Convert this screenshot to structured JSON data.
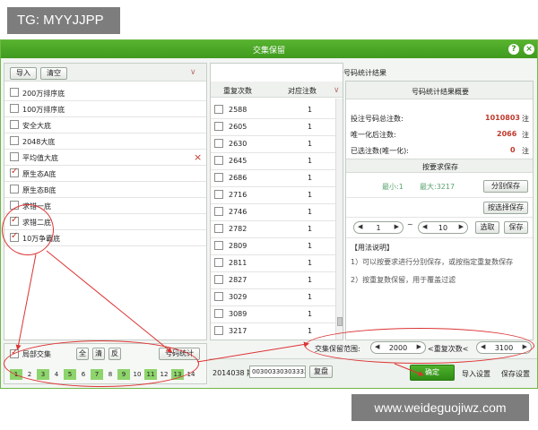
{
  "watermark_top": "TG: MYYJJPP",
  "watermark_bottom": "www.weideguojiwz.com",
  "window": {
    "title": "交集保留",
    "help": "?",
    "close": "×"
  },
  "left": {
    "import": "导入",
    "clear": "清空",
    "items": [
      {
        "label": "200万排序底",
        "checked": false
      },
      {
        "label": "100万排序底",
        "checked": false
      },
      {
        "label": "安全大底",
        "checked": false
      },
      {
        "label": "2048大底",
        "checked": false
      },
      {
        "label": "平均值大底",
        "checked": false
      },
      {
        "label": "原生态A底",
        "checked": true
      },
      {
        "label": "原生态B底",
        "checked": false
      },
      {
        "label": "求错一底",
        "checked": false
      },
      {
        "label": "求错二底",
        "checked": true
      },
      {
        "label": "10万争霸底",
        "checked": true
      }
    ],
    "delete_glyph": "×",
    "partial": "局部交集",
    "all": "全",
    "clear_btn": "清",
    "invert": "反",
    "stats": "号码统计",
    "numbers": [
      "1",
      "2",
      "3",
      "4",
      "5",
      "6",
      "7",
      "8",
      "9",
      "10",
      "11",
      "12",
      "13",
      "14"
    ],
    "numbers_on": [
      1,
      3,
      5,
      7,
      9,
      11,
      13
    ]
  },
  "middle": {
    "header": "号码统计结果",
    "col1": "重复次数",
    "col2": "对应注数",
    "rows": [
      {
        "k": "2588",
        "v": "1"
      },
      {
        "k": "2605",
        "v": "1"
      },
      {
        "k": "2630",
        "v": "1"
      },
      {
        "k": "2645",
        "v": "1"
      },
      {
        "k": "2686",
        "v": "1"
      },
      {
        "k": "2716",
        "v": "1"
      },
      {
        "k": "2746",
        "v": "1"
      },
      {
        "k": "2782",
        "v": "1"
      },
      {
        "k": "2809",
        "v": "1"
      },
      {
        "k": "2811",
        "v": "1"
      },
      {
        "k": "2827",
        "v": "1"
      },
      {
        "k": "3029",
        "v": "1"
      },
      {
        "k": "3089",
        "v": "1"
      },
      {
        "k": "3217",
        "v": "1"
      }
    ]
  },
  "right": {
    "header": "号码统计结果概要",
    "total_label": "投注号码总注数:",
    "total": "1010803",
    "unit": "注",
    "unique_label": "唯一化后注数:",
    "unique": "2066",
    "selected_label": "已选注数(唯一化):",
    "selected": "0",
    "save_by": "按要求保存",
    "min": "最小:1",
    "max": "最大:3217",
    "split_save": "分别保存",
    "select_save": "按选择保存",
    "range_from": "1",
    "tilde": "~",
    "range_to": "10",
    "pick": "选取",
    "save": "保存",
    "usage_title": "【用法说明】",
    "usage1": "1）可以按要求进行分别保存，或按指定重复数保存",
    "usage2": "2）按重复数保留，用于覆盖过滤"
  },
  "bottom": {
    "period": "2014038 期",
    "code": "00300330303333",
    "copy": "复盘",
    "range_label": "交集保留范围:",
    "range_min": "2000",
    "lt_label": "<重复次数<",
    "range_max": "3100",
    "confirm": "确定",
    "import_settings": "导入设置",
    "save_settings": "保存设置"
  },
  "colors": {
    "titlebar": "#3f9a1e",
    "accent_red": "#c0392b",
    "annotation": "#dd3333",
    "selected_num": "#8ed46c"
  }
}
